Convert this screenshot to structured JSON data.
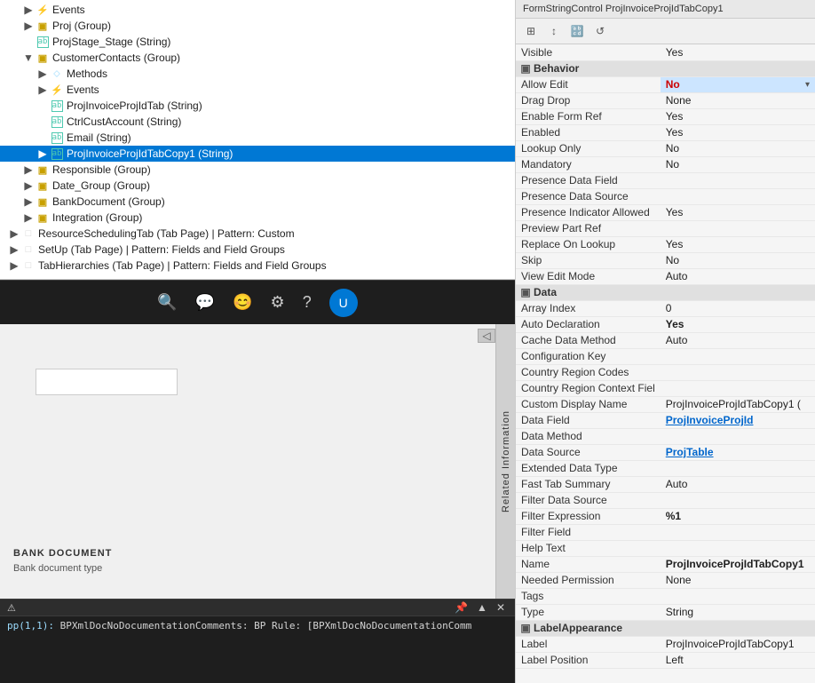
{
  "header": {
    "title": "FormStringControl ProjInvoiceProjIdTabCopy1"
  },
  "propsToolbar": {
    "buttons": [
      "⊞",
      "↕",
      "🔡",
      "⟳"
    ]
  },
  "tree": {
    "items": [
      {
        "indent": 1,
        "expand": "▶",
        "icon": "event",
        "text": "Events",
        "selected": false
      },
      {
        "indent": 1,
        "expand": "▶",
        "icon": "group",
        "text": "Proj (Group)",
        "selected": false
      },
      {
        "indent": 1,
        "expand": "",
        "icon": "string",
        "text": "ProjStage_Stage (String)",
        "selected": false
      },
      {
        "indent": 1,
        "expand": "▼",
        "icon": "group",
        "text": "CustomerContacts (Group)",
        "selected": false
      },
      {
        "indent": 2,
        "expand": "▶",
        "icon": "method",
        "text": "Methods",
        "selected": false
      },
      {
        "indent": 2,
        "expand": "▶",
        "icon": "event",
        "text": "Events",
        "selected": false
      },
      {
        "indent": 2,
        "expand": "",
        "icon": "string",
        "text": "ProjInvoiceProjIdTab (String)",
        "selected": false
      },
      {
        "indent": 2,
        "expand": "",
        "icon": "string",
        "text": "CtrlCustAccount (String)",
        "selected": false
      },
      {
        "indent": 2,
        "expand": "",
        "icon": "string",
        "text": "Email (String)",
        "selected": false
      },
      {
        "indent": 2,
        "expand": "▶",
        "icon": "string",
        "text": "ProjInvoiceProjIdTabCopy1 (String)",
        "selected": true
      },
      {
        "indent": 1,
        "expand": "▶",
        "icon": "group",
        "text": "Responsible (Group)",
        "selected": false
      },
      {
        "indent": 1,
        "expand": "▶",
        "icon": "group",
        "text": "Date_Group (Group)",
        "selected": false
      },
      {
        "indent": 1,
        "expand": "▶",
        "icon": "group",
        "text": "BankDocument (Group)",
        "selected": false
      },
      {
        "indent": 1,
        "expand": "▶",
        "icon": "group",
        "text": "Integration (Group)",
        "selected": false
      },
      {
        "indent": 0,
        "expand": "▶",
        "icon": "tabpage",
        "text": "ResourceSchedulingTab (Tab Page) | Pattern: Custom",
        "selected": false
      },
      {
        "indent": 0,
        "expand": "▶",
        "icon": "tabpage",
        "text": "SetUp (Tab Page) | Pattern: Fields and Field Groups",
        "selected": false
      },
      {
        "indent": 0,
        "expand": "▶",
        "icon": "tabpage",
        "text": "TabHierarchies (Tab Page) | Pattern: Fields and Field Groups",
        "selected": false
      }
    ]
  },
  "properties": {
    "visible_value": "Yes",
    "sections": [
      {
        "name": "Behavior",
        "rows": [
          {
            "key": "Allow Edit",
            "value": "No",
            "bold": true,
            "highlight": true,
            "redBorder": true,
            "hasDropdown": true
          },
          {
            "key": "Drag Drop",
            "value": "None",
            "bold": false
          },
          {
            "key": "Enable Form Ref",
            "value": "Yes",
            "bold": false
          },
          {
            "key": "Enabled",
            "value": "Yes",
            "bold": false
          },
          {
            "key": "Lookup Only",
            "value": "No",
            "bold": false
          },
          {
            "key": "Mandatory",
            "value": "No",
            "bold": false
          },
          {
            "key": "Presence Data Field",
            "value": "",
            "bold": false
          },
          {
            "key": "Presence Data Source",
            "value": "",
            "bold": false
          },
          {
            "key": "Presence Indicator Allowed",
            "value": "Yes",
            "bold": false
          },
          {
            "key": "Preview Part Ref",
            "value": "",
            "bold": false
          },
          {
            "key": "Replace On Lookup",
            "value": "Yes",
            "bold": false
          },
          {
            "key": "Skip",
            "value": "No",
            "bold": false
          },
          {
            "key": "View Edit Mode",
            "value": "Auto",
            "bold": false
          }
        ]
      },
      {
        "name": "Data",
        "rows": [
          {
            "key": "Array Index",
            "value": "0",
            "bold": false
          },
          {
            "key": "Auto Declaration",
            "value": "Yes",
            "bold": true
          },
          {
            "key": "Cache Data Method",
            "value": "Auto",
            "bold": false
          },
          {
            "key": "Configuration Key",
            "value": "",
            "bold": false
          },
          {
            "key": "Country Region Codes",
            "value": "",
            "bold": false
          },
          {
            "key": "Country Region Context Fiel",
            "value": "",
            "bold": false
          },
          {
            "key": "Custom Display Name",
            "value": "ProjInvoiceProjIdTabCopy1 (",
            "bold": false
          },
          {
            "key": "Data Field",
            "value": "ProjInvoiceProjId",
            "bold": true,
            "link": true
          },
          {
            "key": "Data Method",
            "value": "",
            "bold": false
          },
          {
            "key": "Data Source",
            "value": "ProjTable",
            "bold": true,
            "link": true
          },
          {
            "key": "Extended Data Type",
            "value": "",
            "bold": false
          },
          {
            "key": "Fast Tab Summary",
            "value": "Auto",
            "bold": false
          },
          {
            "key": "Filter Data Source",
            "value": "",
            "bold": false
          },
          {
            "key": "Filter Expression",
            "value": "%1",
            "bold": true
          },
          {
            "key": "Filter Field",
            "value": "",
            "bold": false
          },
          {
            "key": "Help Text",
            "value": "",
            "bold": false
          },
          {
            "key": "Name",
            "value": "ProjInvoiceProjIdTabCopy1",
            "bold": true,
            "redBorder": true
          },
          {
            "key": "Needed Permission",
            "value": "None",
            "bold": false
          },
          {
            "key": "Tags",
            "value": "",
            "bold": false
          },
          {
            "key": "Type",
            "value": "String",
            "bold": false
          }
        ]
      },
      {
        "name": "LabelAppearance",
        "rows": [
          {
            "key": "Label",
            "value": "ProjInvoiceProjIdTabCopy1",
            "bold": false
          },
          {
            "key": "Label Position",
            "value": "Left",
            "bold": false
          }
        ]
      }
    ]
  },
  "toolbar": {
    "icons": [
      "🔍",
      "💬",
      "😊",
      "⚙",
      "?"
    ]
  },
  "errorPanel": {
    "lines": [
      "pp(1,1): BPXml DocNoDocumentationComments: BP Rule: [BPXmlDocNoDocumentationComm"
    ]
  },
  "preview": {
    "bankDocLabel": "BANK DOCUMENT",
    "bankDocSub": "Bank document type",
    "relatedInfo": "Related Information"
  }
}
